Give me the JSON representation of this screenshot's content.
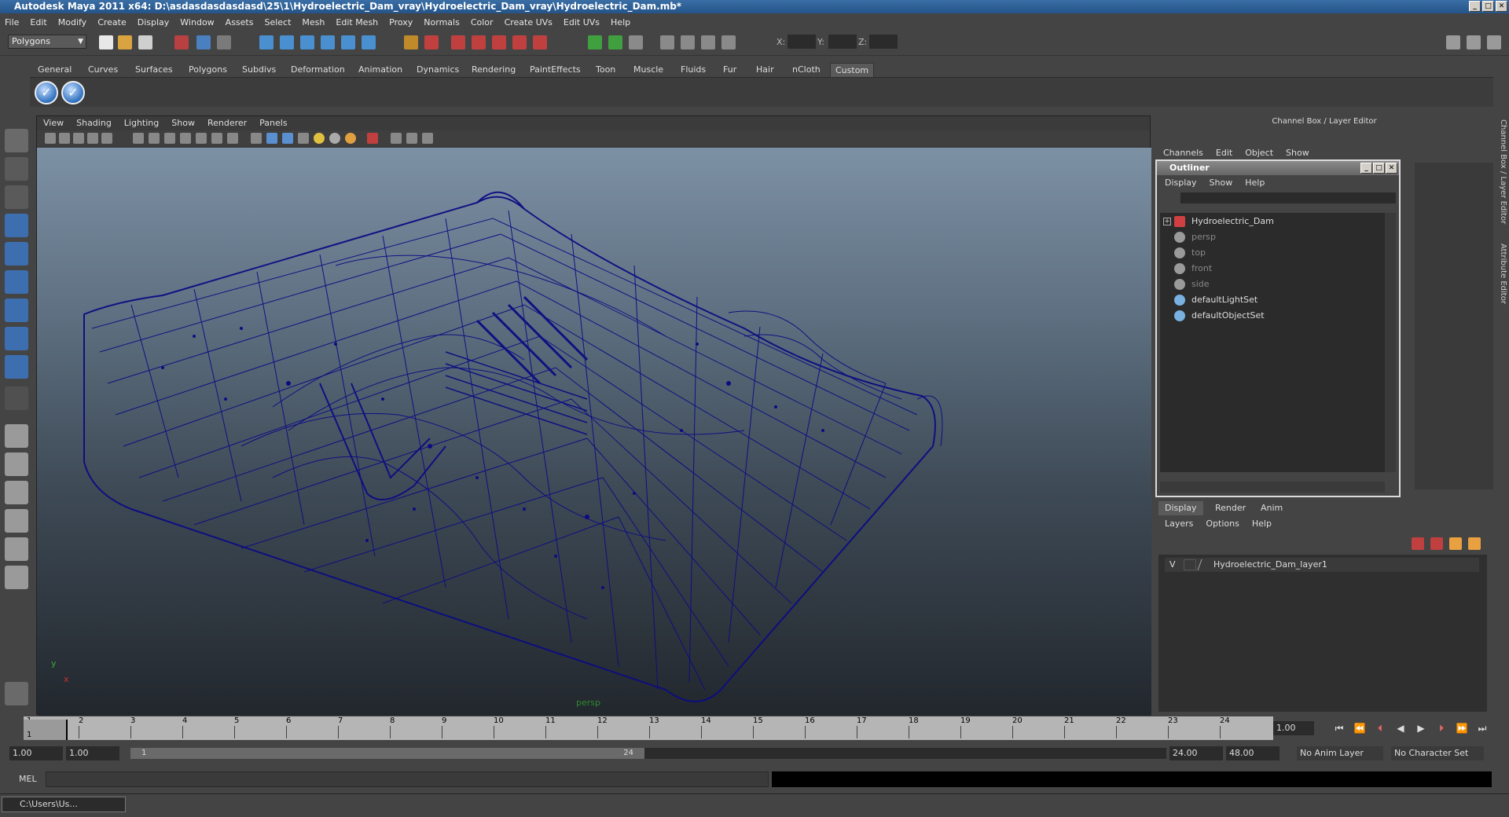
{
  "window": {
    "title": "Autodesk Maya 2011 x64: D:\\asdasdasdasdasd\\25\\1\\Hydroelectric_Dam_vray\\Hydroelectric_Dam_vray\\Hydroelectric_Dam.mb*"
  },
  "menubar": [
    "File",
    "Edit",
    "Modify",
    "Create",
    "Display",
    "Window",
    "Assets",
    "Select",
    "Mesh",
    "Edit Mesh",
    "Proxy",
    "Normals",
    "Color",
    "Create UVs",
    "Edit UVs",
    "Help"
  ],
  "statusline": {
    "menuset": "Polygons",
    "x_label": "X:",
    "y_label": "Y:",
    "z_label": "Z:"
  },
  "shelf_tabs": [
    "General",
    "Curves",
    "Surfaces",
    "Polygons",
    "Subdivs",
    "Deformation",
    "Animation",
    "Dynamics",
    "Rendering",
    "PaintEffects",
    "Toon",
    "Muscle",
    "Fluids",
    "Fur",
    "Hair",
    "nCloth",
    "Custom"
  ],
  "shelf_active": "Custom",
  "viewport": {
    "menu": [
      "View",
      "Shading",
      "Lighting",
      "Show",
      "Renderer",
      "Panels"
    ],
    "camera_label": "persp",
    "axis_y": "y",
    "axis_x": "x"
  },
  "channel_box": {
    "title": "Channel Box / Layer Editor",
    "menu": [
      "Channels",
      "Edit",
      "Object",
      "Show"
    ]
  },
  "outliner": {
    "title": "Outliner",
    "menu": [
      "Display",
      "Show",
      "Help"
    ],
    "items": [
      {
        "label": "Hydroelectric_Dam",
        "dim": false,
        "icon_color": "#d04040"
      },
      {
        "label": "persp",
        "dim": true,
        "icon_color": "#9a9a9a"
      },
      {
        "label": "top",
        "dim": true,
        "icon_color": "#9a9a9a"
      },
      {
        "label": "front",
        "dim": true,
        "icon_color": "#9a9a9a"
      },
      {
        "label": "side",
        "dim": true,
        "icon_color": "#9a9a9a"
      },
      {
        "label": "defaultLightSet",
        "dim": false,
        "icon_color": "#7ab0e0"
      },
      {
        "label": "defaultObjectSet",
        "dim": false,
        "icon_color": "#7ab0e0"
      }
    ]
  },
  "layer_editor": {
    "tabs": [
      "Display",
      "Render",
      "Anim"
    ],
    "active_tab": "Display",
    "menu": [
      "Layers",
      "Options",
      "Help"
    ],
    "layer": {
      "visibility": "V",
      "name": "Hydroelectric_Dam_layer1"
    }
  },
  "vertical_tabs": [
    "Channel Box / Layer Editor",
    "Attribute Editor"
  ],
  "timeline": {
    "ticks": [
      "1",
      "2",
      "3",
      "4",
      "5",
      "6",
      "7",
      "8",
      "9",
      "10",
      "11",
      "12",
      "13",
      "14",
      "15",
      "16",
      "17",
      "18",
      "19",
      "20",
      "21",
      "22",
      "23",
      "24"
    ],
    "current_frame": "1.00",
    "playhead_label": "1"
  },
  "range": {
    "start": "1.00",
    "playback_start": "1.00",
    "slider_start": "1",
    "slider_end": "24",
    "playback_end": "24.00",
    "end": "48.00",
    "anim_layer": "No Anim Layer",
    "character_set": "No Character Set"
  },
  "command_line": {
    "label": "MEL"
  },
  "taskbar": {
    "item": "C:\\Users\\Us..."
  },
  "colors": {
    "wireframe": "#0a0a80",
    "accent": "#2e6fbf",
    "camera_label": "#2e8b2e"
  }
}
